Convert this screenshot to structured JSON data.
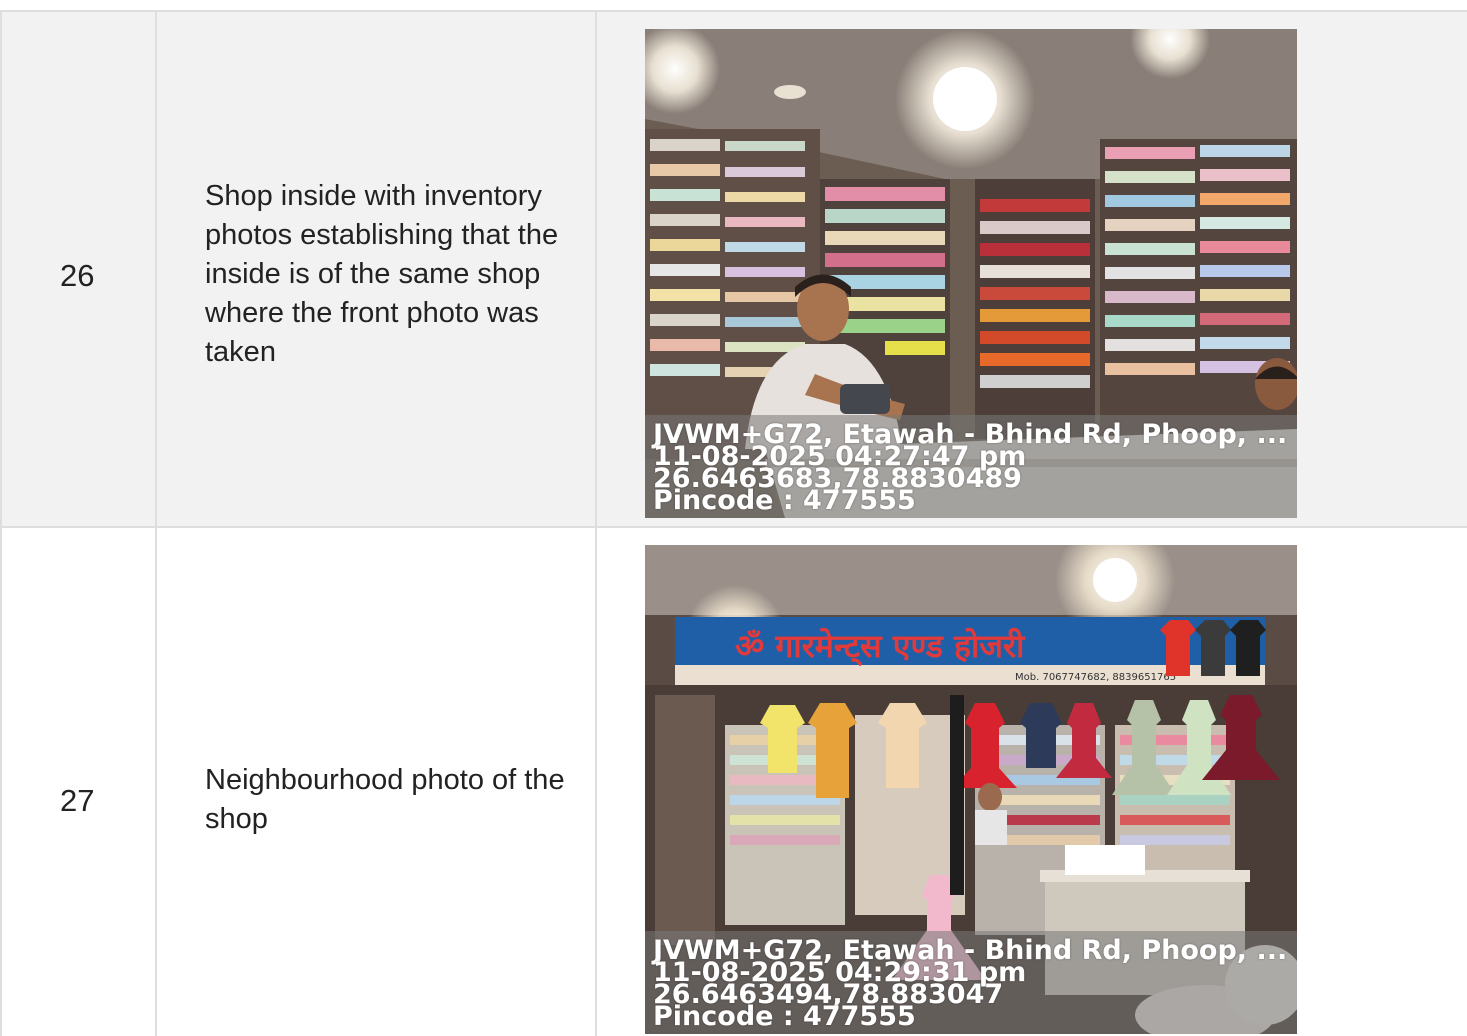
{
  "rows": [
    {
      "number": "26",
      "description": "Shop inside with inventory photos establishing that the inside is of the same shop where the front photo was taken",
      "stamp": {
        "line1": "JVWM+G72, Etawah - Bhind Rd, Phoop, ...",
        "line2": "11-08-2025 04:27:47 pm",
        "line3": "26.6463683,78.8830489",
        "line4": "Pincode : 477555"
      }
    },
    {
      "number": "27",
      "description": "Neighbourhood photo of the shop",
      "shop_sign": "ॐ गारमेन्ट्स एण्ड होजरी",
      "shop_phone": "Mob. 7067747682, 8839651765",
      "stamp": {
        "line1": "JVWM+G72, Etawah - Bhind Rd, Phoop, ...",
        "line2": "11-08-2025 04:29:31 pm",
        "line3": "26.6463494,78.883047",
        "line4": "Pincode : 477555"
      }
    }
  ]
}
